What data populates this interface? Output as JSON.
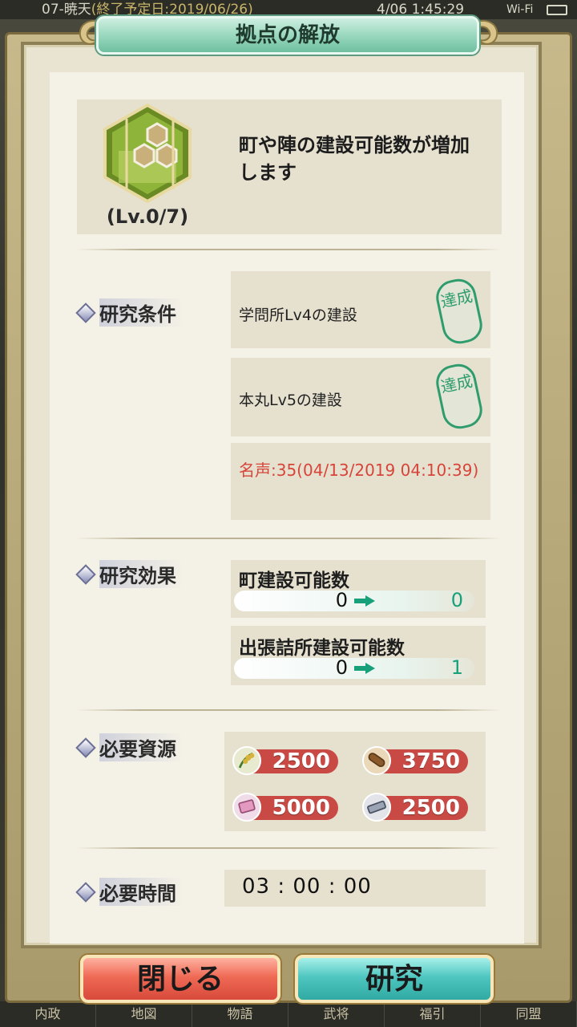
{
  "status_bar": {
    "left_text": "07-暁天",
    "left_sub": "(終了予定日:2019/06/26)",
    "time": "4/06 1:45:29",
    "wifi": "Wi-Fi"
  },
  "dialog": {
    "title": "拠点の解放",
    "level": "(Lv.0/7)",
    "description": "町や陣の建設可能数が増加します",
    "sections": {
      "conditions_label": "研究条件",
      "effects_label": "研究効果",
      "resources_label": "必要資源",
      "time_label": "必要時間"
    },
    "conditions": [
      {
        "text": "学問所Lv4の建設",
        "stamp": "達成"
      },
      {
        "text": "本丸Lv5の建設",
        "stamp": "達成"
      }
    ],
    "condition_fame": "名声:35(04/13/2019 04:10:39)",
    "effects": [
      {
        "name": "町建設可能数",
        "from": "0",
        "to": "0"
      },
      {
        "name": "出張詰所建設可能数",
        "from": "0",
        "to": "1"
      }
    ],
    "resources": [
      {
        "icon": "rice-icon",
        "value": "2500"
      },
      {
        "icon": "wood-icon",
        "value": "3750"
      },
      {
        "icon": "cloth-icon",
        "value": "5000"
      },
      {
        "icon": "iron-icon",
        "value": "2500"
      }
    ],
    "required_time": "03 : 00 : 00",
    "buttons": {
      "close": "閉じる",
      "research": "研究"
    },
    "colors": {
      "accent_green": "#17a07a",
      "alert_red": "#d7443a",
      "resource_pill": "#c94a44"
    }
  },
  "bottom_nav": [
    "内政",
    "地図",
    "物語",
    "武将",
    "福引",
    "同盟"
  ]
}
